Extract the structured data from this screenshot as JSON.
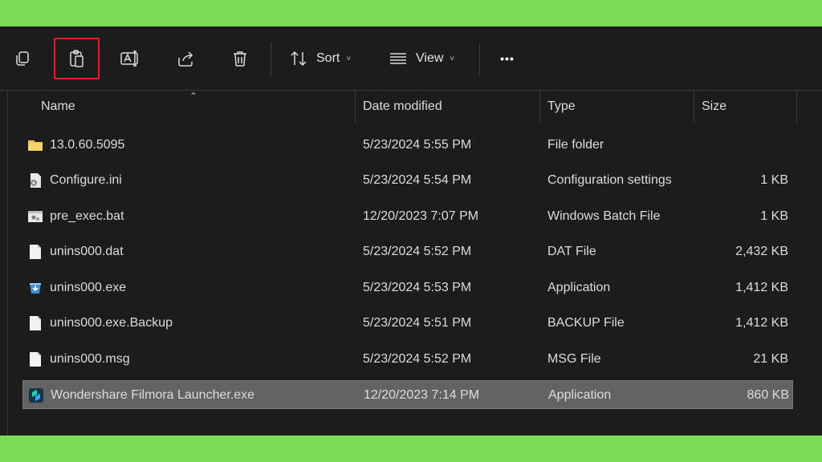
{
  "toolbar": {
    "sort_label": "Sort",
    "view_label": "View",
    "chevron": "˅",
    "more": "•••"
  },
  "columns": {
    "name": "Name",
    "date": "Date modified",
    "type": "Type",
    "size": "Size"
  },
  "files": [
    {
      "name": "13.0.60.5095",
      "date": "5/23/2024 5:55 PM",
      "type": "File folder",
      "size": "",
      "icon": "folder-icon"
    },
    {
      "name": "Configure.ini",
      "date": "5/23/2024 5:54 PM",
      "type": "Configuration settings",
      "size": "1 KB",
      "icon": "settings-file-icon"
    },
    {
      "name": "pre_exec.bat",
      "date": "12/20/2023 7:07 PM",
      "type": "Windows Batch File",
      "size": "1 KB",
      "icon": "batch-file-icon"
    },
    {
      "name": "unins000.dat",
      "date": "5/23/2024 5:52 PM",
      "type": "DAT File",
      "size": "2,432 KB",
      "icon": "file-icon"
    },
    {
      "name": "unins000.exe",
      "date": "5/23/2024 5:53 PM",
      "type": "Application",
      "size": "1,412 KB",
      "icon": "installer-icon"
    },
    {
      "name": "unins000.exe.Backup",
      "date": "5/23/2024 5:51 PM",
      "type": "BACKUP File",
      "size": "1,412 KB",
      "icon": "file-icon"
    },
    {
      "name": "unins000.msg",
      "date": "5/23/2024 5:52 PM",
      "type": "MSG File",
      "size": "21 KB",
      "icon": "file-icon"
    },
    {
      "name": "Wondershare Filmora Launcher.exe",
      "date": "12/20/2023 7:14 PM",
      "type": "Application",
      "size": "860 KB",
      "icon": "filmora-app-icon",
      "selected": true
    }
  ],
  "colors": {
    "page_bg": "#7ed957",
    "window_bg": "#1c1c1c",
    "selection": "#636363",
    "highlight_border": "#e0202a",
    "folder": "#f2c14e"
  }
}
